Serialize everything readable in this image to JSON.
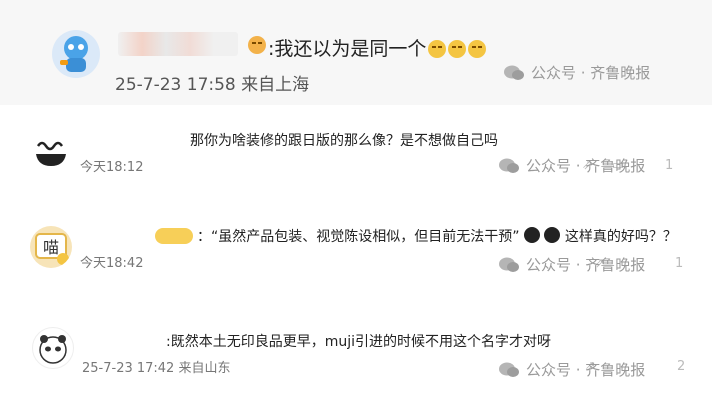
{
  "comments": [
    {
      "text": ":我还以为是同一个",
      "meta": "25-7-23 17:58 来自上海"
    },
    {
      "text": "那你为啥装修的跟日版的那么像？是不想做自己吗",
      "meta": "今天18:12",
      "count": "1"
    },
    {
      "text": "：“虽然产品包装、视觉陈设相似，但目前无法干预”",
      "text_tail": "这样真的好吗？？",
      "meta": "今天18:42",
      "count": "1"
    },
    {
      "text": ":既然本土无印良品更早，muji引进的时候不用这个名字才对呀",
      "meta": "25-7-23 17:42 来自山东",
      "count": "2"
    }
  ],
  "watermark": {
    "label": "公众号 · 齐鲁晚报"
  },
  "colors": {
    "highlight_bg": "#f7f7f7",
    "meta": "#777777",
    "watermark": "#9a9a9a"
  }
}
